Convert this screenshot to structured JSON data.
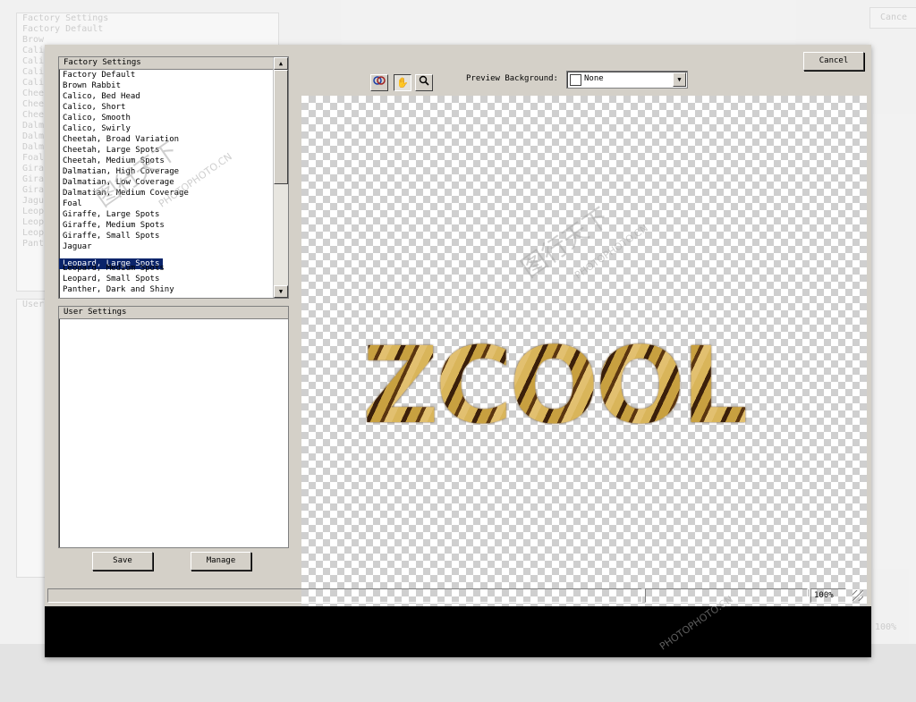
{
  "background": {
    "list_items": [
      "Factory Settings",
      "Factory Default",
      "Brow",
      "Cali",
      "Cali",
      "Cali",
      "Cali",
      "Chee",
      "Chee",
      "Chee",
      "Dalm",
      "Dalm",
      "Dalm",
      "Foal",
      "Gira",
      "Gira",
      "Gira",
      "Jagu",
      "Leop",
      "Leop",
      "Leop",
      "Pant"
    ],
    "user_header": "User",
    "cancel_label": "Cance",
    "zoom": "100%"
  },
  "dialog": {
    "factory_settings": {
      "header": "Factory Settings",
      "items": [
        "Factory Default",
        "Brown Rabbit",
        "Calico, Bed Head",
        "Calico, Short",
        "Calico, Smooth",
        "Calico, Swirly",
        "Cheetah, Broad Variation",
        "Cheetah, Large Spots",
        "Cheetah, Medium Spots",
        "Dalmatian, High Coverage",
        "Dalmatian, Low Coverage",
        "Dalmatian, Medium Coverage",
        "Foal",
        "Giraffe, Large Spots",
        "Giraffe, Medium Spots",
        "Giraffe, Small Spots",
        "Jaguar",
        "Leopard, Large Spots",
        "Leopard, Medium Spots",
        "Leopard, Small Spots",
        "Panther, Dark and Shiny"
      ],
      "selected": "Leopard, Large Spots"
    },
    "user_settings": {
      "header": "User Settings"
    },
    "buttons": {
      "save": "Save",
      "manage": "Manage",
      "cancel": "Cancel"
    },
    "toolbar": {
      "tools": [
        "preview-icon",
        "hand-icon",
        "zoom-icon"
      ]
    },
    "preview_background": {
      "label": "Preview Background:",
      "value": "None"
    },
    "preview_text": "ZCOOL",
    "status": {
      "zoom": "100%"
    }
  },
  "watermarks": [
    "图行天下",
    "PHOTOPHOTO.CN"
  ]
}
